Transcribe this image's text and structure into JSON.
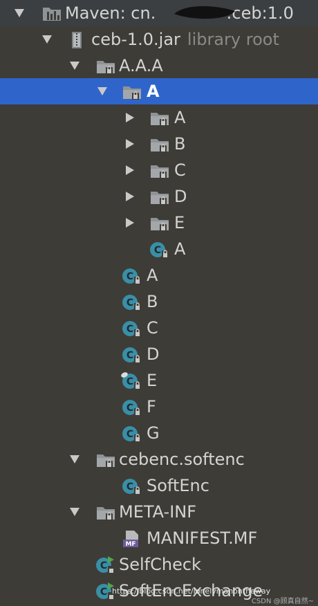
{
  "tree": {
    "root": {
      "label": "Maven: cn.",
      "label_tail": ":ceb:1.0"
    },
    "jar": {
      "label": "ceb-1.0.jar",
      "suffix": "library root"
    },
    "pkg_aaa": {
      "label": "A.A.A"
    },
    "pkg_a": {
      "label": "A"
    },
    "sub_packages": [
      {
        "label": "A"
      },
      {
        "label": "B"
      },
      {
        "label": "C"
      },
      {
        "label": "D"
      },
      {
        "label": "E"
      }
    ],
    "inner_class": {
      "label": "A"
    },
    "classes": [
      {
        "label": "A"
      },
      {
        "label": "B"
      },
      {
        "label": "C"
      },
      {
        "label": "D"
      },
      {
        "label": "E"
      },
      {
        "label": "F"
      },
      {
        "label": "G"
      }
    ],
    "pkg_cebenc": {
      "label": "cebenc.softenc"
    },
    "softenc": {
      "label": "SoftEnc"
    },
    "meta_inf": {
      "label": "META-INF"
    },
    "manifest": {
      "label": "MANIFEST.MF",
      "icon_text": "MF"
    },
    "selfcheck": {
      "label": "SelfCheck"
    },
    "softencexchange": {
      "label": "SoftEncExchange"
    }
  },
  "icon_glyph": "C",
  "watermark": "https://blog.csdn.net/lonelymanontheway",
  "watermark_tail": "CSDN @顾真自然~",
  "colors": {
    "background": "#3d3c37",
    "selection": "#2f65ca",
    "class_icon": "#3a8fa6",
    "folder": "#8f9396",
    "text": "#d4d4d4",
    "dim_text": "#8a8a86",
    "run_marker": "#4fa64f"
  }
}
